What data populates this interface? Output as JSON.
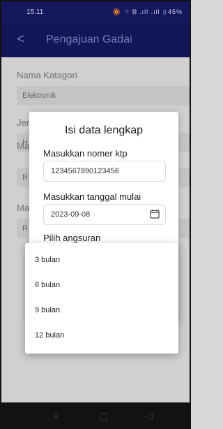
{
  "status_bar": {
    "time": "15.11",
    "icons_text": "🔕 ⌔ 𝄃𝄃 .ıll .ıll ▯45%"
  },
  "app_bar": {
    "back_glyph": "<",
    "title": "Pengajuan Gadai"
  },
  "background_form": {
    "nama_kategori_label": "Nama Katagori",
    "nama_kategori_value": "Elektronik",
    "partial_label_1": "Jer",
    "partial_value_1": "H",
    "partial_label_2": "Ma",
    "partial_value_2": "R",
    "partial_label_3": "Ma",
    "partial_value_3": "R"
  },
  "dialog": {
    "title": "Isi data lengkap",
    "ktp_label": "Masukkan nomer ktp",
    "ktp_value": "1234567890123456",
    "date_label": "Masukkan tanggal mulai",
    "date_value": "2023-09-08",
    "installment_label": "Pilih angsuran"
  },
  "installment_menu": {
    "options": [
      "3 bulan",
      "6 bulan",
      "9 bulan",
      "12 bulan"
    ]
  },
  "nav_bar": {
    "menu_glyph": "≡",
    "home_glyph": "▢",
    "back_glyph": "◁"
  }
}
